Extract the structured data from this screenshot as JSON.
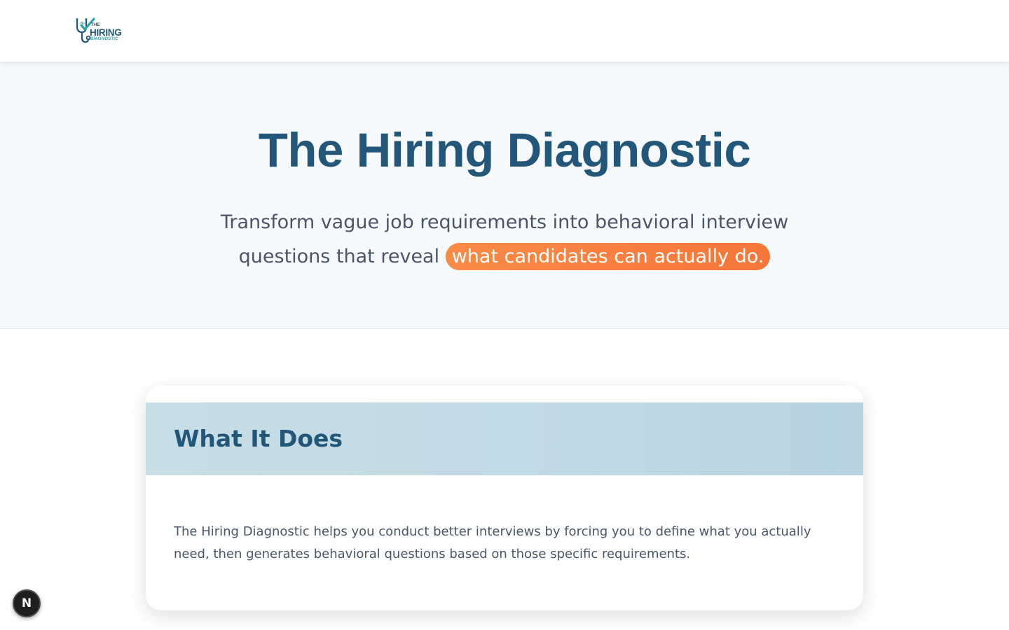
{
  "header": {
    "logo": {
      "line1": "THE",
      "line2": "HIRING",
      "line3": "DIAGNOSTIC"
    }
  },
  "hero": {
    "title": "The Hiring Diagnostic",
    "subtitle_text": "Transform vague job requirements into behavioral interview questions that reveal",
    "subtitle_highlight": "what candidates can actually do."
  },
  "card": {
    "title": "What It Does",
    "body": "The Hiring Diagnostic helps you conduct better interviews by forcing you to define what you actually need, then generates behavioral questions based on those specific requirements."
  },
  "dev_badge": {
    "label": "N"
  },
  "colors": {
    "brand_navy": "#22577a",
    "accent_teal": "#2aa0a8",
    "highlight_orange": "#f6763a",
    "body_text": "#4a5568",
    "card_header_bg": "#c1d9e3"
  },
  "icons": {
    "logo_icon": "stethoscope-checkmark-icon"
  }
}
